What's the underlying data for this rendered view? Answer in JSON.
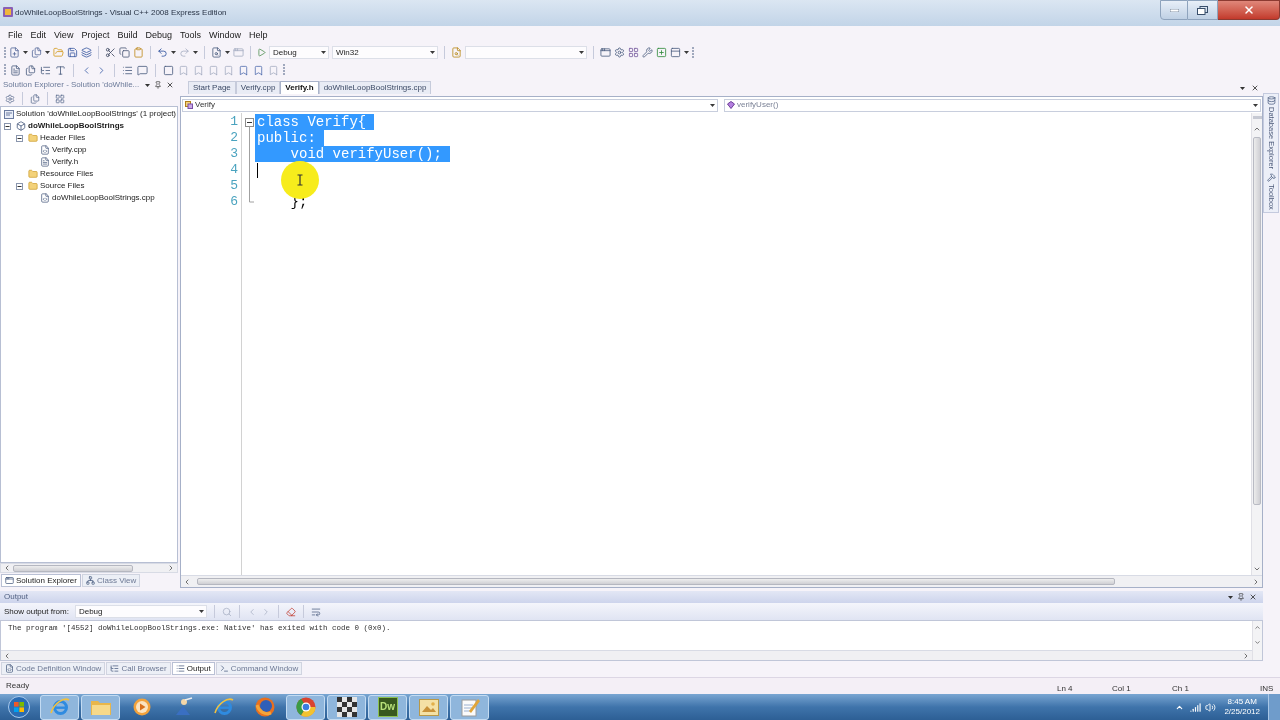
{
  "window": {
    "title": "doWhileLoopBoolStrings - Visual C++ 2008 Express Edition"
  },
  "menu": [
    "File",
    "Edit",
    "View",
    "Project",
    "Build",
    "Debug",
    "Tools",
    "Window",
    "Help"
  ],
  "toolbar": {
    "configuration": "Debug",
    "platform": "Win32"
  },
  "solution_explorer": {
    "title": "Solution Explorer - Solution 'doWhile...",
    "tree": [
      {
        "kind": "solution",
        "label": "Solution 'doWhileLoopBoolStrings' (1 project)",
        "children": [
          {
            "kind": "project",
            "label": "doWhileLoopBoolStrings",
            "expanded": true,
            "children": [
              {
                "kind": "folder",
                "label": "Header Files",
                "expanded": true,
                "children": [
                  {
                    "kind": "source",
                    "label": "Verify.cpp"
                  },
                  {
                    "kind": "header",
                    "label": "Verify.h"
                  }
                ]
              },
              {
                "kind": "folder",
                "label": "Resource Files"
              },
              {
                "kind": "folder",
                "label": "Source Files",
                "expanded": true,
                "children": [
                  {
                    "kind": "source",
                    "label": "doWhileLoopBoolStrings.cpp"
                  }
                ]
              }
            ]
          }
        ]
      }
    ],
    "tabs": [
      {
        "kind": "solution",
        "label": "Solution Explorer",
        "selected": true
      },
      {
        "kind": "classes",
        "label": "Class View",
        "selected": false
      }
    ]
  },
  "editor": {
    "tabs": [
      {
        "label": "Start Page",
        "selected": false
      },
      {
        "label": "Verify.cpp",
        "selected": false
      },
      {
        "label": "Verify.h",
        "selected": true
      },
      {
        "label": "doWhileLoopBoolStrings.cpp",
        "selected": false
      }
    ],
    "scope": "Verify",
    "member": "verifyUser()",
    "lines": [
      {
        "kind": "open",
        "number": "1",
        "text": "class Verify{",
        "selected": true,
        "caret": false
      },
      {
        "kind": "inner",
        "number": "2",
        "text": "public:",
        "selected": true,
        "caret": false
      },
      {
        "kind": "inner",
        "number": "3",
        "text": "    void verifyUser();",
        "selected": true,
        "caret": false
      },
      {
        "kind": "inner",
        "number": "4",
        "selected": false,
        "caret": true
      },
      {
        "kind": "inner",
        "number": "5",
        "selected": false,
        "caret": false
      },
      {
        "kind": "close",
        "number": "6",
        "text": "    };",
        "selected": false,
        "caret": false
      }
    ]
  },
  "side_tabs": [
    {
      "kind": "database",
      "label": "Database Explorer"
    },
    {
      "kind": "toolbox",
      "label": "Toolbox"
    }
  ],
  "output": {
    "title": "Output",
    "source_label": "Show output from:",
    "source": "Debug",
    "lines": [
      "The program '[4552] doWhileLoopBoolStrings.exe: Native' has exited with code 0 (0x0)."
    ],
    "tabs": [
      {
        "kind": "definition",
        "label": "Code Definition Window",
        "selected": false
      },
      {
        "kind": "browser",
        "label": "Call Browser",
        "selected": false
      },
      {
        "kind": "output",
        "label": "Output",
        "selected": true
      },
      {
        "kind": "command",
        "label": "Command Window",
        "selected": false
      }
    ]
  },
  "status_bar": {
    "message": "Ready",
    "line": "Ln 4",
    "column": "Col 1",
    "char": "Ch 1",
    "mode": "INS"
  },
  "taskbar": {
    "buttons": [
      {
        "kind": "globe",
        "running": true
      },
      {
        "kind": "folder",
        "running": true
      },
      {
        "kind": "player",
        "running": false
      },
      {
        "kind": "figure",
        "running": false
      },
      {
        "kind": "globe",
        "running": false
      },
      {
        "kind": "fox",
        "running": false
      },
      {
        "kind": "wheel",
        "running": true
      },
      {
        "kind": "board",
        "running": true
      },
      {
        "kind": "badge",
        "label": "Dw",
        "running": true
      },
      {
        "kind": "picture",
        "running": true
      },
      {
        "kind": "notepad",
        "running": true
      }
    ],
    "time": "8:45 AM",
    "date": "2/25/2012"
  }
}
